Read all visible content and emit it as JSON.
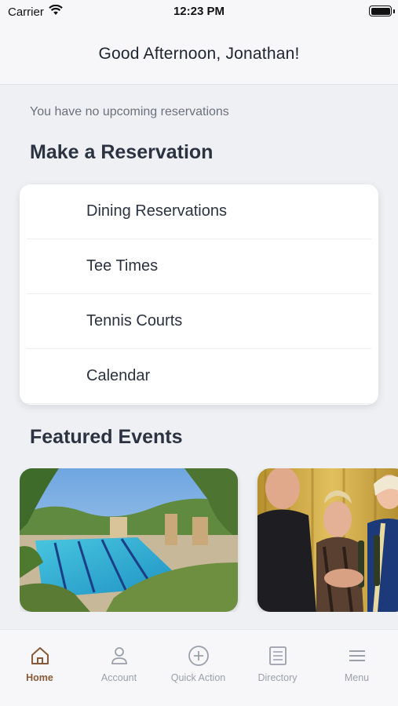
{
  "status_bar": {
    "carrier": "Carrier",
    "time": "12:23 PM"
  },
  "header": {
    "greeting": "Good Afternoon, Jonathan!"
  },
  "reservations": {
    "empty_message": "You have no upcoming reservations",
    "section_title": "Make a Reservation",
    "items": [
      {
        "label": "Dining Reservations"
      },
      {
        "label": "Tee Times"
      },
      {
        "label": "Tennis Courts"
      },
      {
        "label": "Calendar"
      }
    ]
  },
  "events": {
    "section_title": "Featured Events",
    "cards": [
      {
        "image": "pool-resort-photo"
      },
      {
        "image": "members-celebration-photo"
      }
    ]
  },
  "tab_bar": {
    "tabs": [
      {
        "label": "Home",
        "icon": "home-icon",
        "active": true
      },
      {
        "label": "Account",
        "icon": "person-icon",
        "active": false
      },
      {
        "label": "Quick Action",
        "icon": "plus-circle-icon",
        "active": false
      },
      {
        "label": "Directory",
        "icon": "list-icon",
        "active": false
      },
      {
        "label": "Menu",
        "icon": "hamburger-icon",
        "active": false
      }
    ],
    "active_color": "#8a5a38",
    "inactive_color": "#9aa0aa"
  }
}
